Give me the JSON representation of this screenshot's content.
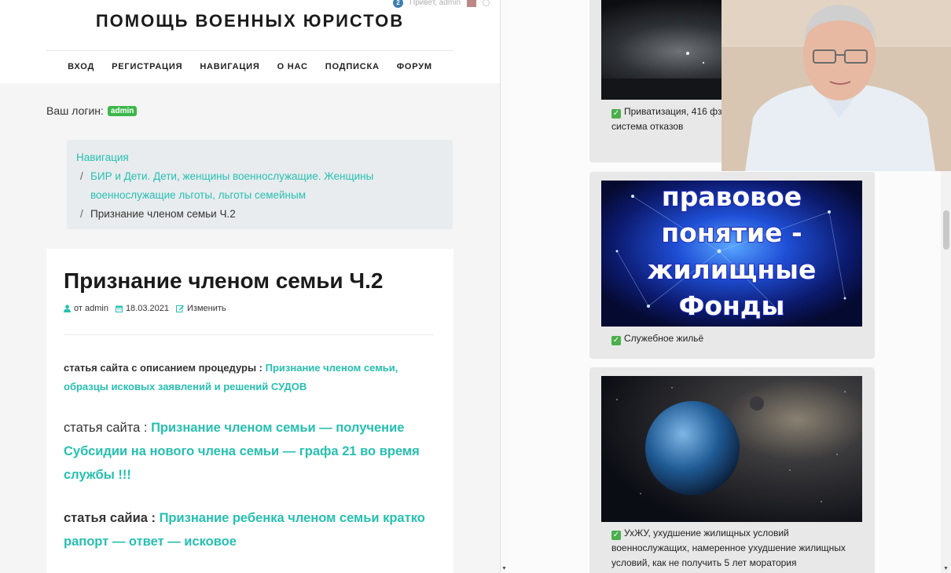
{
  "header": {
    "site_title": "ПОМОЩЬ ВОЕННЫХ ЮРИСТОВ",
    "notification_count": "2",
    "greeting": "Привет, admin",
    "nav": [
      "ВХОД",
      "РЕГИСТРАЦИЯ",
      "НАВИГАЦИЯ",
      "О НАС",
      "ПОДПИСКА",
      "ФОРУМ"
    ]
  },
  "login": {
    "label": "Ваш логин:",
    "username": "admin"
  },
  "breadcrumb": {
    "root": "Навигация",
    "separator": "/",
    "parent_line1": "БИР и Дети. Дети, женщины военнослужащие. Женщины",
    "parent_line2": "военнослужащие льготы, льготы семейным",
    "current": "Признание членом семьи Ч.2"
  },
  "article": {
    "title": "Признание членом семьи Ч.2",
    "author": "от admin",
    "date": "18.03.2021",
    "edit": "Изменить",
    "p1_prefix": "статья сайта с описанием процедуры :",
    "p1_link": "Признание членом семьи, образцы исковых заявлений и решений СУДОВ",
    "p2_prefix": "статья сайта :",
    "p2_link": "Признание членом семьи — получение Субсидии на нового члена семьи — графа 21 во время службы !!!",
    "p3_prefix": "статья сайиа :",
    "p3_link": "Признание ребенка членом семьи кратко рапорт — ответ — исковое"
  },
  "sidebar_cards": [
    {
      "caption": "Приватизация, 416 фз второй раз - особенности система отказов"
    },
    {
      "thumb_lines": [
        "правовое",
        "понятие -",
        "жилищные",
        "Фонды"
      ],
      "caption": "Служебное жильё"
    },
    {
      "caption": "УхЖУ, ухудшение жилищных условий военнослужащих, намеренное ухудшение жилищных условий, как не получить 5 лет моратория"
    }
  ],
  "colors": {
    "accent_teal": "#26c0b0",
    "badge_green": "#3cb84a",
    "thumb_text_stroke": "#1d2bb5"
  }
}
